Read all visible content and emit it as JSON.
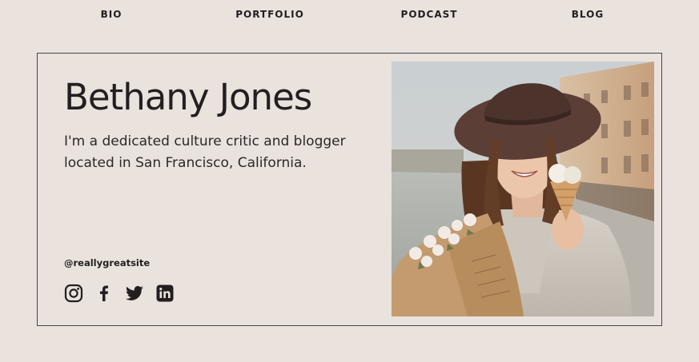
{
  "nav": {
    "items": [
      {
        "label": "BIO"
      },
      {
        "label": "PORTFOLIO"
      },
      {
        "label": "PODCAST"
      },
      {
        "label": "BLOG"
      }
    ]
  },
  "profile": {
    "name": "Bethany Jones",
    "bio": "I'm a dedicated culture critic and blogger located in San Francisco, California.",
    "handle": "@reallygreatsite"
  },
  "socials": [
    {
      "icon": "instagram-icon"
    },
    {
      "icon": "facebook-icon"
    },
    {
      "icon": "twitter-icon"
    },
    {
      "icon": "linkedin-icon"
    }
  ],
  "colors": {
    "background": "#e9e2dd",
    "text": "#231f20",
    "border": "#4a4546"
  }
}
